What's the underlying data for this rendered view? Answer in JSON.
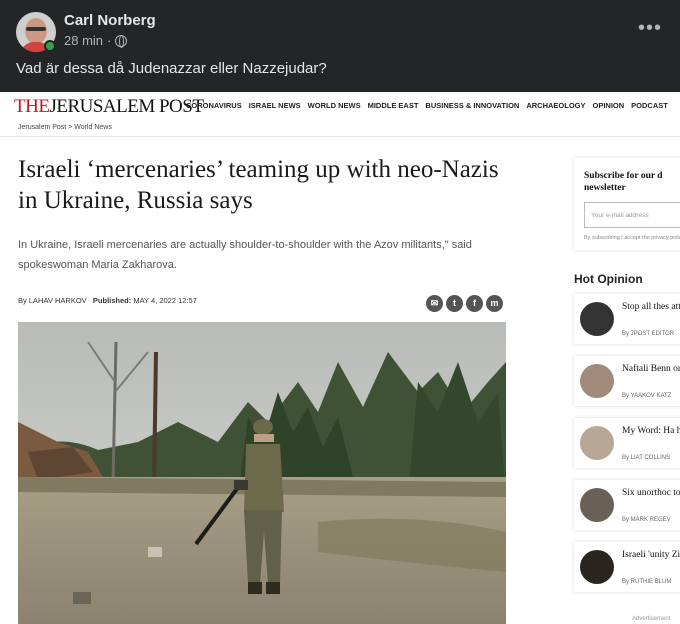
{
  "post": {
    "author": "Carl Norberg",
    "time": "28 min",
    "separator": "·",
    "text": "Vad är dessa då Judenazzar eller Nazzejudar?",
    "icons": [
      "avatar",
      "online-status",
      "globe-icon",
      "more-icon"
    ]
  },
  "article": {
    "logo_prefix": "THE",
    "logo_rest": "JERUSALEM POST",
    "nav": [
      "CORONAVIRUS",
      "ISRAEL NEWS",
      "WORLD NEWS",
      "MIDDLE EAST",
      "BUSINESS & INNOVATION",
      "ARCHAEOLOGY",
      "OPINION",
      "PODCAST"
    ],
    "breadcrumb": "Jerusalem Post  >  World News",
    "headline": "Israeli ‘mercenaries’ teaming up with neo-Nazis in Ukraine, Russia says",
    "summary": "In Ukraine, Israeli mercenaries are actually shoulder-to-shoulder with the Azov militants,\" said spokeswoman Maria Zakharova.",
    "byline_prefix": "By",
    "author": "LAHAV HARKOV",
    "published_label": "Published:",
    "published": "MAY 4, 2022 12:57",
    "share_icons": [
      "email-icon",
      "twitter-icon",
      "facebook-icon",
      "messenger-icon"
    ]
  },
  "sidebar": {
    "subscribe_title": "Subscribe for our d newsletter",
    "email_placeholder": "Your e-mail address",
    "legal": "By subscribing I accept the privacy policy",
    "hot_title": "Hot Opinion",
    "opinions": [
      {
        "title": "Stop all thes attain Israel",
        "author": "By JPOST EDITOR"
      },
      {
        "title": "Naftali Benn on a Russia",
        "author": "By YAAKOV KATZ"
      },
      {
        "title": "My Word: Ha here",
        "author": "By LIAT COLLINS"
      },
      {
        "title": "Six unorthoc to celebrate",
        "author": "By MARK REGEV"
      },
      {
        "title": "Israeli 'unity Zionism",
        "author": "By RUTHIE BLUM"
      }
    ],
    "advert": "Advertisement"
  }
}
